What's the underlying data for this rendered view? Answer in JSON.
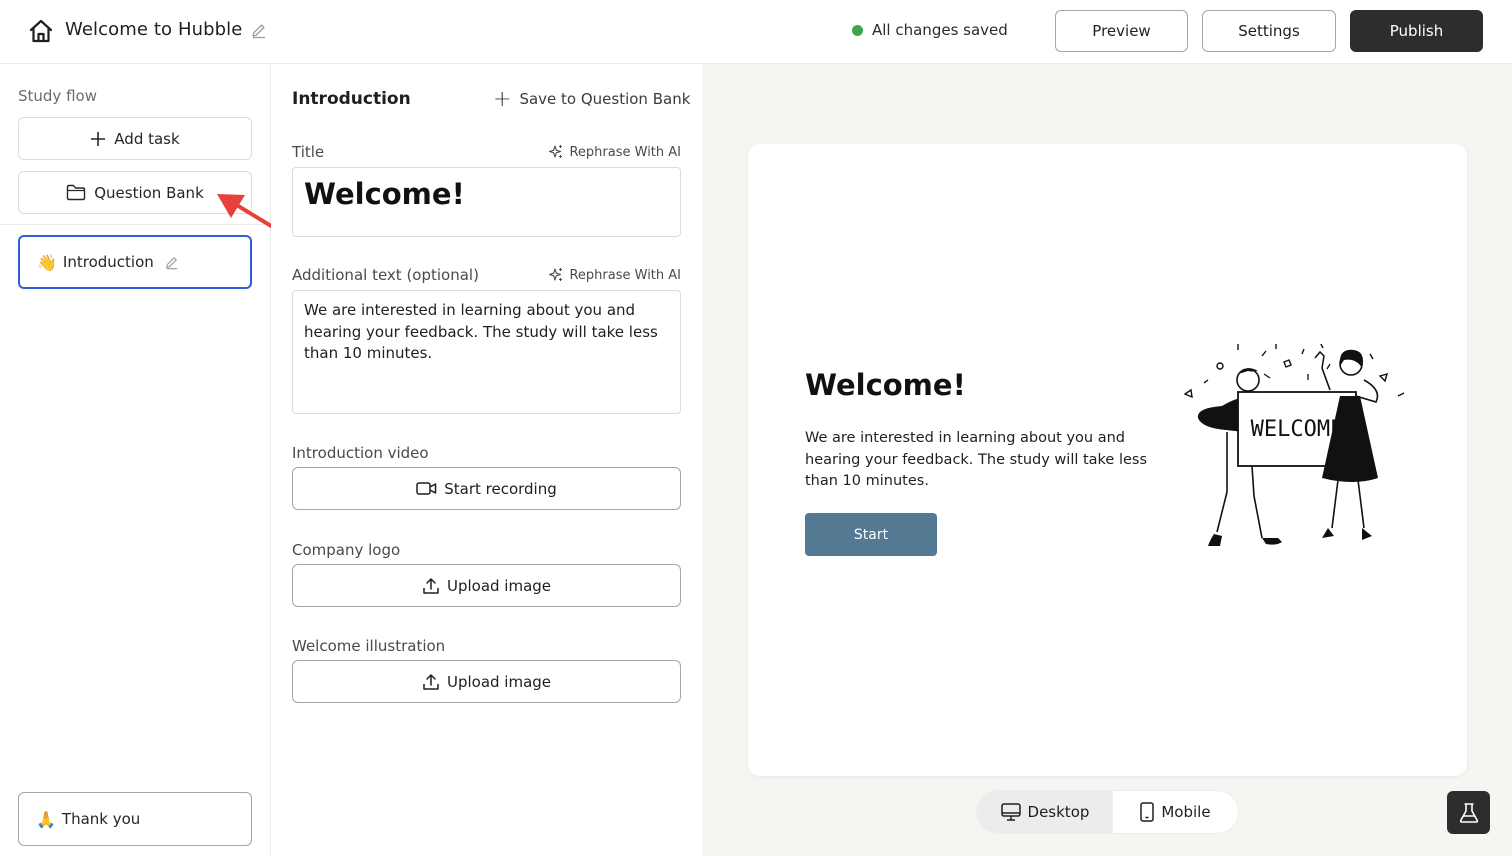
{
  "header": {
    "home_icon": "home-icon",
    "title": "Welcome to Hubble",
    "edit_icon": "pencil-icon",
    "status_text": "All changes saved",
    "status_color": "#3fa451",
    "preview_label": "Preview",
    "settings_label": "Settings",
    "publish_label": "Publish"
  },
  "sidebar": {
    "heading": "Study flow",
    "add_task_label": "Add task",
    "question_bank_label": "Question Bank",
    "items": [
      {
        "emoji": "👋",
        "label": "Introduction",
        "selected": true
      },
      {
        "emoji": "🙏",
        "label": "Thank you",
        "selected": false
      }
    ]
  },
  "editor": {
    "title": "Introduction",
    "save_to_bank_label": "Save to Question Bank",
    "title_label": "Title",
    "rephrase_label": "Rephrase With AI",
    "title_value": "Welcome!",
    "additional_label": "Additional text (optional)",
    "additional_value": "We are interested in learning about you and hearing your feedback. The study will take less than 10 minutes.",
    "video_label": "Introduction video",
    "start_recording_label": "Start recording",
    "logo_label": "Company logo",
    "upload_label": "Upload image",
    "illustration_label": "Welcome illustration"
  },
  "preview": {
    "title": "Welcome!",
    "text": "We are interested in learning about you and hearing your feedback. The study will take less than 10 minutes.",
    "start_label": "Start",
    "start_color": "#557893",
    "sign_text": "WELCOME",
    "desktop_label": "Desktop",
    "mobile_label": "Mobile",
    "selected_device": "Desktop"
  },
  "colors": {
    "accent_selected": "#2f5fd8",
    "annotation_arrow": "#e8403a",
    "dark_button": "#2d2d2d"
  }
}
